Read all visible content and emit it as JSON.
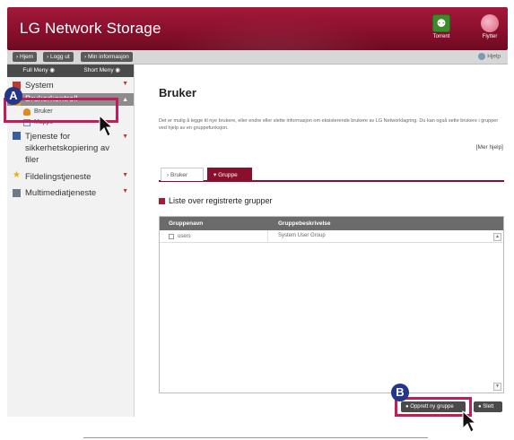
{
  "header": {
    "title": "LG Network Storage",
    "buttons": [
      {
        "label": "Torrent",
        "icon": "torrent-icon"
      },
      {
        "label": "Flytter",
        "icon": "flytter-icon"
      }
    ],
    "colors": {
      "brand": "#8a0f2c"
    }
  },
  "navbar": {
    "buttons": [
      "Hjem",
      "Logg ut",
      "Min informasjon"
    ],
    "help": "Hjelp"
  },
  "sidebar": {
    "tabs": [
      "Full Meny",
      "Short Meny"
    ],
    "items": [
      {
        "label": "System",
        "icon": "system-icon"
      },
      {
        "label": "Brukerkontroll",
        "icon": "user-control-icon"
      },
      {
        "label": "Tjeneste for sikkerhetskopiering av filer",
        "icon": "backup-icon"
      },
      {
        "label": "Fildelingstjeneste",
        "icon": "star-icon"
      },
      {
        "label": "Multimediatjeneste",
        "icon": "multimedia-icon"
      }
    ],
    "subitems": [
      {
        "label": "Bruker",
        "icon": "user-icon"
      },
      {
        "label": "Mappe",
        "icon": "folder-icon"
      }
    ]
  },
  "main": {
    "title": "Bruker",
    "description": "Det er mulig å legge til nye brukere, eller endre eller slette informasjon om eksisterende brukere av LG Networklagring. Du kan også sette brukere i grupper ved hjelp av en gruppefunksjon.",
    "more": "[Mer hjelp]",
    "tabs": [
      "Bruker",
      "Gruppe"
    ],
    "section_title": "Liste over registrerte grupper",
    "table": {
      "headers": [
        "Gruppenavn",
        "Gruppebeskrivelse"
      ],
      "rows": [
        {
          "name": "users",
          "description": "System User Group"
        }
      ]
    },
    "buttons": {
      "create": "Opprett ny gruppe",
      "delete": "Slett"
    }
  },
  "callouts": {
    "a": "A",
    "b": "B"
  }
}
